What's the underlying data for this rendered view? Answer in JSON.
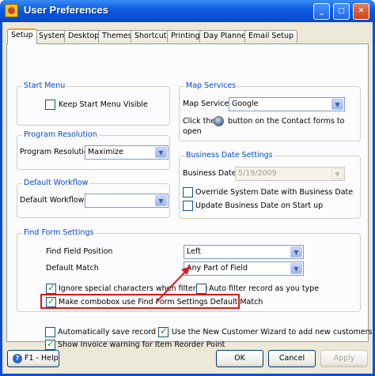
{
  "window": {
    "title": "User Preferences",
    "controls": {
      "minimize": "_",
      "maximize": "□",
      "close": "✕"
    }
  },
  "tabs": [
    {
      "label": "Setup",
      "active": true
    },
    {
      "label": "System"
    },
    {
      "label": "Desktop"
    },
    {
      "label": "Themes"
    },
    {
      "label": "Shortcuts"
    },
    {
      "label": "Printing"
    },
    {
      "label": "Day Planner"
    },
    {
      "label": "Email Setup"
    }
  ],
  "start_menu": {
    "title": "Start Menu",
    "keep_visible": {
      "label": "Keep Start Menu Visible",
      "checked": false
    }
  },
  "program_resolution": {
    "title": "Program Resolution",
    "label": "Program Resolution",
    "value": "Maximize"
  },
  "default_workflow": {
    "title": "Default Workflow",
    "label": "Default Workflow",
    "value": ""
  },
  "map_services": {
    "title": "Map Services",
    "label": "Map Service",
    "value": "Google",
    "hint_prefix": "Click the",
    "hint_suffix": "button on the Contact forms to",
    "hint_line2": "open"
  },
  "business_date": {
    "title": "Business Date Settings",
    "label": "Business Date",
    "value": "5/19/2009",
    "override": {
      "label": "Override System Date with Business Date",
      "checked": false
    },
    "update": {
      "label": "Update Business Date on Start up",
      "checked": false
    }
  },
  "find_form": {
    "title": "Find Form Settings",
    "field_position_label": "Find Field Position",
    "field_position_value": "Left",
    "default_match_label": "Default Match",
    "default_match_value": "Any Part of Field",
    "ignore_special": {
      "label": "Ignore special characters when filtering",
      "checked": true
    },
    "auto_filter": {
      "label": "Auto filter record as you type",
      "checked": false
    },
    "make_combobox": {
      "label": "Make combobox use Find Form Settings Default Match",
      "checked": true
    }
  },
  "misc": {
    "auto_save": {
      "label": "Automatically save record",
      "checked": false
    },
    "new_customer_wizard": {
      "label": "Use the New Customer Wizard to add new customers",
      "checked": true
    },
    "invoice_warning": {
      "label": "Show Invoice warning for Item Reorder Point",
      "checked": true
    }
  },
  "footer": {
    "help": "F1 - Help",
    "ok": "OK",
    "cancel": "Cancel",
    "apply": "Apply"
  },
  "colors": {
    "titlebar": "#0b5ae3",
    "group_title": "#0046d5",
    "highlight": "#e01818"
  }
}
